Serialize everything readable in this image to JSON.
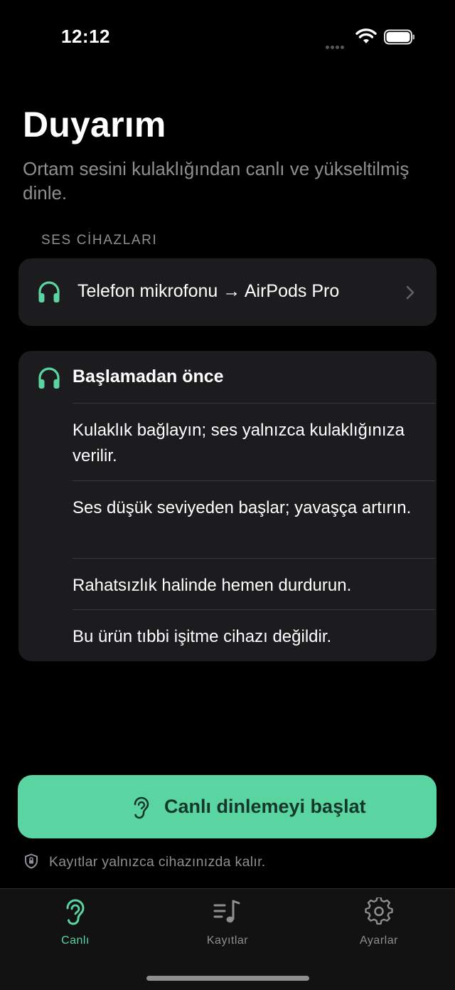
{
  "status_bar": {
    "time": "12:12"
  },
  "header": {
    "title": "Duyarım",
    "subtitle": "Ortam sesini kulaklığından canlı ve yükseltilmiş dinle."
  },
  "devices_section": {
    "label": "SES CİHAZLARI",
    "route_label": "Telefon mikrofonu → AirPods Pro",
    "icon": "headphones-icon"
  },
  "before_start": {
    "title": "Başlamadan önce",
    "items": [
      "Kulaklık bağlayın; ses yalnızca kulaklığınıza verilir.",
      "Ses düşük seviyeden başlar; yavaşça artırın.",
      "Rahatsızlık halinde hemen durdurun.",
      "Bu ürün tıbbi işitme cihazı değildir."
    ]
  },
  "primary_action": {
    "label": "Canlı dinlemeyi başlat",
    "icon": "ear-icon"
  },
  "privacy_note": {
    "text": "Kayıtlar yalnızca cihazınızda kalır.",
    "icon": "shield-icon"
  },
  "tab_bar": {
    "tabs": [
      {
        "label": "Canlı",
        "icon": "ear-icon",
        "active": true
      },
      {
        "label": "Kayıtlar",
        "icon": "music-list-icon",
        "active": false
      },
      {
        "label": "Ayarlar",
        "icon": "gear-icon",
        "active": false
      }
    ]
  },
  "colors": {
    "accent": "#5ad4a1",
    "background": "#000000",
    "card": "#1c1c1e",
    "secondary_text": "#8e8e93"
  }
}
